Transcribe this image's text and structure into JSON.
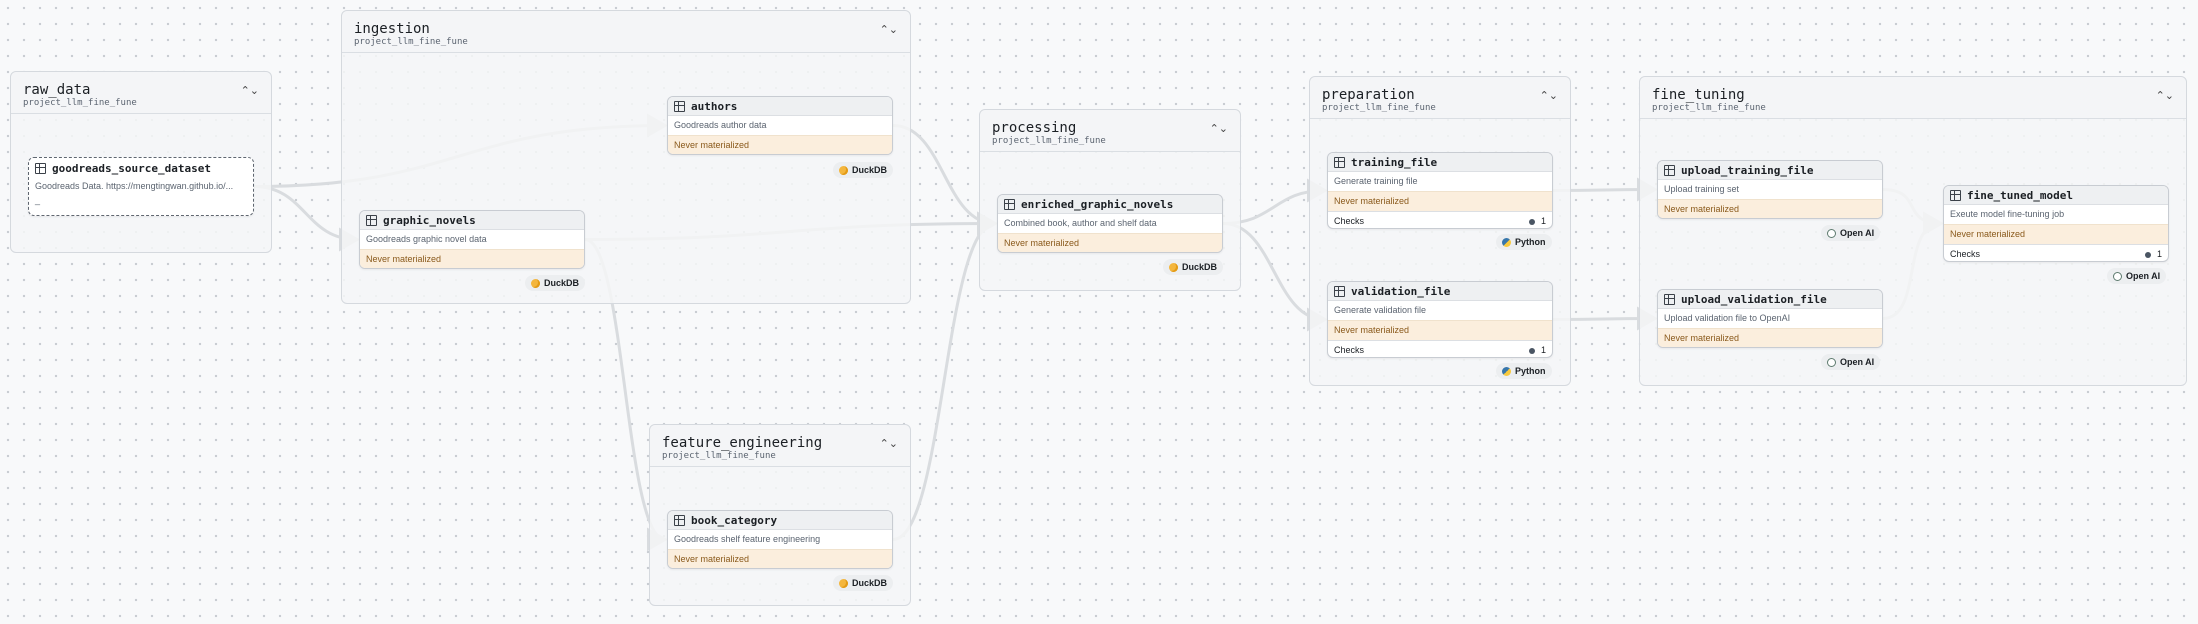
{
  "groups": [
    {
      "key": "raw_data",
      "title": "raw_data",
      "subtitle": "project_llm_fine_fune",
      "collapse_icon": "⌃⌄"
    },
    {
      "key": "ingestion",
      "title": "ingestion",
      "subtitle": "project_llm_fine_fune",
      "collapse_icon": "⌃⌄"
    },
    {
      "key": "processing",
      "title": "processing",
      "subtitle": "project_llm_fine_fune",
      "collapse_icon": "⌃⌄"
    },
    {
      "key": "preparation",
      "title": "preparation",
      "subtitle": "project_llm_fine_fune",
      "collapse_icon": "⌃⌄"
    },
    {
      "key": "fine_tuning",
      "title": "fine_tuning",
      "subtitle": "project_llm_fine_fune",
      "collapse_icon": "⌃⌄"
    },
    {
      "key": "feature_engineering",
      "title": "feature_engineering",
      "subtitle": "project_llm_fine_fune",
      "collapse_icon": "⌃⌄"
    }
  ],
  "nodes": {
    "goodreads_source_dataset": {
      "title": "goodreads_source_dataset",
      "description": "Goodreads Data. https://mengtingwan.github.io/...",
      "extra": "_"
    },
    "authors": {
      "title": "authors",
      "description": "Goodreads author data",
      "status": "Never materialized"
    },
    "graphic_novels": {
      "title": "graphic_novels",
      "description": "Goodreads graphic novel data",
      "status": "Never materialized"
    },
    "book_category": {
      "title": "book_category",
      "description": "Goodreads shelf feature engineering",
      "status": "Never materialized"
    },
    "enriched_graphic_novels": {
      "title": "enriched_graphic_novels",
      "description": "Combined book, author and shelf data",
      "status": "Never materialized"
    },
    "training_file": {
      "title": "training_file",
      "description": "Generate training file",
      "status": "Never materialized",
      "checks_label": "Checks",
      "checks_count": "1"
    },
    "validation_file": {
      "title": "validation_file",
      "description": "Generate validation file",
      "status": "Never materialized",
      "checks_label": "Checks",
      "checks_count": "1"
    },
    "upload_training_file": {
      "title": "upload_training_file",
      "description": "Upload training set",
      "status": "Never materialized"
    },
    "upload_validation_file": {
      "title": "upload_validation_file",
      "description": "Upload validation file to OpenAI",
      "status": "Never materialized"
    },
    "fine_tuned_model": {
      "title": "fine_tuned_model",
      "description": "Exeute model fine-tuning job",
      "status": "Never materialized",
      "checks_label": "Checks",
      "checks_count": "1"
    }
  },
  "badges": {
    "authors": {
      "label": "DuckDB",
      "icon": "duckdb-icon"
    },
    "graphic_novels": {
      "label": "DuckDB",
      "icon": "duckdb-icon"
    },
    "book_category": {
      "label": "DuckDB",
      "icon": "duckdb-icon"
    },
    "enriched_graphic_novels": {
      "label": "DuckDB",
      "icon": "duckdb-icon"
    },
    "training_file": {
      "label": "Python",
      "icon": "python-icon"
    },
    "validation_file": {
      "label": "Python",
      "icon": "python-icon"
    },
    "upload_training_file": {
      "label": "Open AI",
      "icon": "openai-icon"
    },
    "upload_validation_file": {
      "label": "Open AI",
      "icon": "openai-icon"
    },
    "fine_tuned_model": {
      "label": "Open AI",
      "icon": "openai-icon"
    }
  },
  "edges": [
    [
      "goodreads_source_dataset",
      "authors"
    ],
    [
      "goodreads_source_dataset",
      "graphic_novels"
    ],
    [
      "authors",
      "enriched_graphic_novels"
    ],
    [
      "graphic_novels",
      "enriched_graphic_novels"
    ],
    [
      "graphic_novels",
      "book_category"
    ],
    [
      "book_category",
      "enriched_graphic_novels"
    ],
    [
      "enriched_graphic_novels",
      "training_file"
    ],
    [
      "enriched_graphic_novels",
      "validation_file"
    ],
    [
      "training_file",
      "upload_training_file"
    ],
    [
      "validation_file",
      "upload_validation_file"
    ],
    [
      "upload_training_file",
      "fine_tuned_model"
    ],
    [
      "upload_validation_file",
      "fine_tuned_model"
    ]
  ],
  "colors": {
    "edge": "#d9dcdf",
    "materialized_bg": "#fbeedd",
    "materialized_text": "#8a5a1c",
    "canvas_bg": "#f8f9fa"
  }
}
